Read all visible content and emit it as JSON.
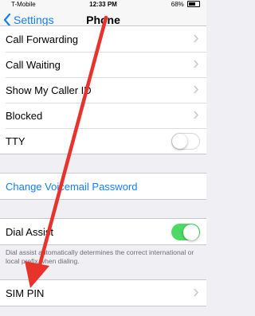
{
  "status_bar": {
    "carrier": "T-Mobile",
    "time": "12:33 PM",
    "battery": "68%"
  },
  "nav": {
    "back_label": "Settings",
    "title": "Phone"
  },
  "group1": {
    "items": [
      {
        "label": "Call Forwarding"
      },
      {
        "label": "Call Waiting"
      },
      {
        "label": "Show My Caller ID"
      },
      {
        "label": "Blocked"
      },
      {
        "label": "TTY",
        "toggle": "off"
      }
    ]
  },
  "group2": {
    "label": "Change Voicemail Password"
  },
  "group3": {
    "label": "Dial Assist",
    "toggle": "on",
    "footnote": "Dial assist automatically determines the correct international or local prefix when dialing."
  },
  "group4": {
    "label": "SIM PIN"
  },
  "colors": {
    "accent": "#147efb",
    "toggle_on": "#4cd964",
    "annotation_arrow": "#e8322c",
    "background": "#efeff4"
  }
}
